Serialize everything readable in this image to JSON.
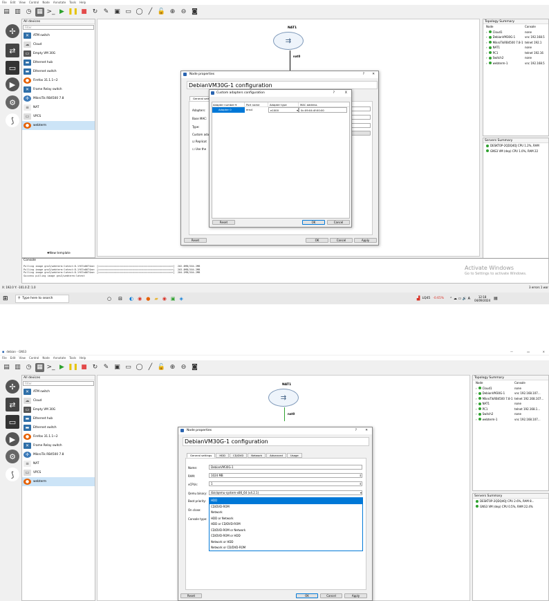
{
  "menu": [
    "File",
    "Edit",
    "View",
    "Control",
    "Node",
    "Annotate",
    "Tools",
    "Help"
  ],
  "window_title_2": "debian - GNS3",
  "devices_panel": {
    "title": "All devices",
    "filter": "Filter",
    "items": [
      "ATM switch",
      "Cloud",
      "Empty VM 30G",
      "Ethernet hub",
      "Ethernet switch",
      "Firefox 31.1.1~2",
      "Frame Relay switch",
      "MikroTik RB4500 7.8",
      "NAT",
      "VPCS",
      "webterm"
    ],
    "new_template": "New template"
  },
  "canvas": {
    "nat_label": "NAT1",
    "link_label": "nat0"
  },
  "topology": {
    "title": "Topology Summary",
    "col_node": "Node",
    "col_console": "Console",
    "rows1": [
      {
        "name": "Cloud1",
        "console": "none"
      },
      {
        "name": "DebianVM30G-1",
        "console": "vnc 192.168.5"
      },
      {
        "name": "MikroTikRB4500 7.8-1",
        "console": "telnet 192.1"
      },
      {
        "name": "NAT1",
        "console": "none"
      },
      {
        "name": "PC1",
        "console": "telnet 192.16"
      },
      {
        "name": "Switch2",
        "console": "none"
      },
      {
        "name": "webterm-1",
        "console": "vnc 192.168.5"
      }
    ],
    "rows2": [
      {
        "name": "Cloud1",
        "console": "none"
      },
      {
        "name": "DebianVM30G-1",
        "console": "vnc 192.168.107..."
      },
      {
        "name": "MikroTikRB4500 7.8-1",
        "console": "telnet 192.168.107..."
      },
      {
        "name": "NAT1",
        "console": "none"
      },
      {
        "name": "PC1",
        "console": "telnet 192.168.1..."
      },
      {
        "name": "Switch2",
        "console": "none"
      },
      {
        "name": "webterm-1",
        "console": "vnc 192.168.107..."
      }
    ]
  },
  "servers": {
    "title": "Servers Summary",
    "s1": [
      "DESKTOP-2QDQ4OJ CPU 1.2%, RAM",
      "GNS3 VM (dep) CPU 1.0%, RAM 22"
    ],
    "s2": [
      "DESKTOP-2QDQ4OJ CPU 2.6%, RAM 8...",
      "GNS3 VM (dep) CPU 0.5%, RAM 22.4%"
    ]
  },
  "console_panel": {
    "title": "Console",
    "lines": [
      "Pulling image gns3/webterm:latest:8.1f67a0674ae: [=================================================>]  202.8MB/204.2MB",
      "Pulling image gns3/webterm:latest:8.1f67a0674ae: [=================================================>]  203.8MB/204.2MB",
      "Pulling image gns3/webterm:latest:8.1f67a0674ae: [=================================================>]  204.2MB/204.2MB",
      "Success pulling image gns3/webterm:latest"
    ]
  },
  "status": {
    "coords": "X: 192.0 Y: -101.0 Z: 1.0",
    "errors": "3 errors 1 war",
    "activate_title": "Activate Windows",
    "activate_sub": "Go to Settings to activate Windows."
  },
  "taskbar": {
    "search": "Type here to search",
    "stock": "LQ45",
    "stock_change": "-0.65%",
    "time": "12:18",
    "date": "04/09/2024"
  },
  "node_props": {
    "title": "Node properties",
    "heading": "DebianVM30G-1 configuration",
    "tabs": [
      "General settings",
      "HDD",
      "CD/DVD",
      "Network",
      "Advanced",
      "Usage"
    ],
    "short_tab": "General sett",
    "reset": "Reset",
    "ok": "OK",
    "cancel": "Cancel",
    "apply": "Apply",
    "labels1": [
      "Adapters:",
      "Base MAC:",
      "Type:",
      "Custom adap",
      "Replicat",
      "Use the"
    ],
    "name_label": "Name:",
    "name_value": "DebianVM30G-1",
    "ram_label": "RAM:",
    "ram_value": "1024 MB",
    "vcpu_label": "vCPUs:",
    "vcpu_value": "1",
    "qemu_label": "Qemu binary:",
    "qemu_value": "/bin/qemu-system-x86_64 (v4.2.1)",
    "boot_label": "Boot priority:",
    "onclose_label": "On close:",
    "console_label": "Console type:",
    "boot_options": [
      "HDD",
      "CD/DVD-ROM",
      "Network",
      "HDD or Network",
      "HDD or CD/DVD-ROM",
      "CD/DVD-ROM or Network",
      "CD/DVD-ROM or HDD",
      "Network or HDD",
      "Network or CD/DVD-ROM"
    ]
  },
  "adapters_dialog": {
    "title": "Custom adapters configuration",
    "help": "?",
    "close": "X",
    "cols": [
      "Adapter number",
      "Port name",
      "Adapter type",
      "MAC address"
    ],
    "row": [
      "Adapter 0",
      "ens4",
      "e1000",
      "0c:09:04:4f:00:00"
    ],
    "reset": "Reset",
    "ok": "OK",
    "cancel": "Cancel"
  }
}
